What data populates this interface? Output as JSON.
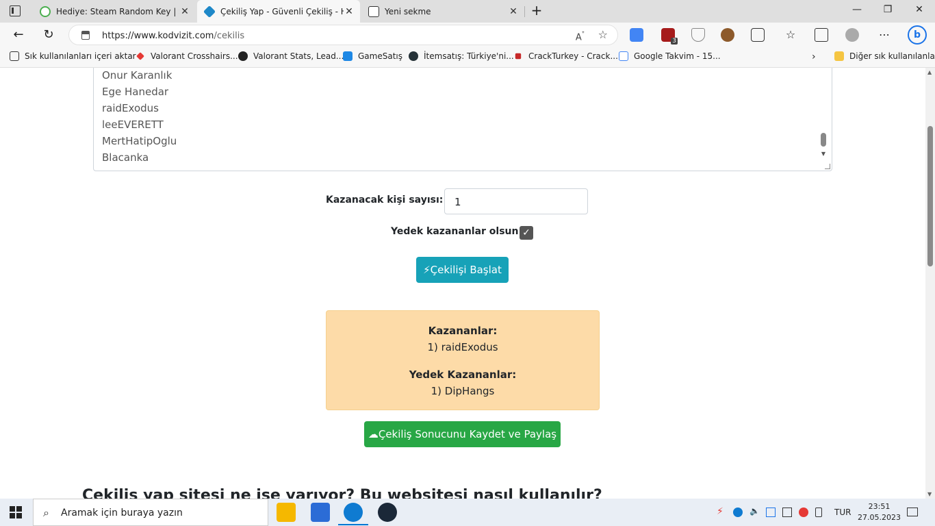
{
  "browser": {
    "tabs": [
      {
        "title": "Hediye: Steam Random Key | Say",
        "active": false
      },
      {
        "title": "Çekiliş Yap - Güvenli Çekiliş - Hızl",
        "active": true
      },
      {
        "title": "Yeni sekme",
        "active": false
      }
    ],
    "url_host": "https://www.kodvizit.com",
    "url_path": "/cekilis",
    "read_aloud": "A̒",
    "extension_badge": "3"
  },
  "bookmarks": [
    "Sık kullanılanları içeri aktar",
    "Valorant Crosshairs...",
    "Valorant Stats, Lead...",
    "GameSatış",
    "İtemsatış: Türkiye'ni...",
    "CrackTurkey - Crack...",
    "Google Takvim - 15..."
  ],
  "bookmarks_other": "Diğer sık kullanılanlar",
  "participants": [
    "Onur Karanlık",
    "Ege Hanedar",
    "raidExodus",
    "leeEVERETT",
    "MertHatipOglu",
    "Blacanka"
  ],
  "form": {
    "winner_count_label": "Kazanacak kişi sayısı:",
    "winner_count_value": "1",
    "backup_label": "Yedek kazananlar olsun:",
    "backup_checked": true,
    "start_button": "Çekilişi Başlat"
  },
  "results": {
    "winners_title": "Kazananlar:",
    "winners": [
      "1) raidExodus"
    ],
    "backup_title": "Yedek Kazananlar:",
    "backups": [
      "1) DipHangs"
    ]
  },
  "save_button": "Çekiliş Sonucunu Kaydet ve Paylaş",
  "section_heading": "Çekiliş yap sitesi ne işe yarıyor? Bu websitesi nasıl kullanılır?",
  "taskbar": {
    "search_placeholder": "Aramak için buraya yazın",
    "language": "TUR",
    "time": "23:51",
    "date": "27.05.2023"
  },
  "colors": {
    "start_button": "#17a2b8",
    "save_button": "#28a745",
    "result_bg": "#fddba8"
  }
}
